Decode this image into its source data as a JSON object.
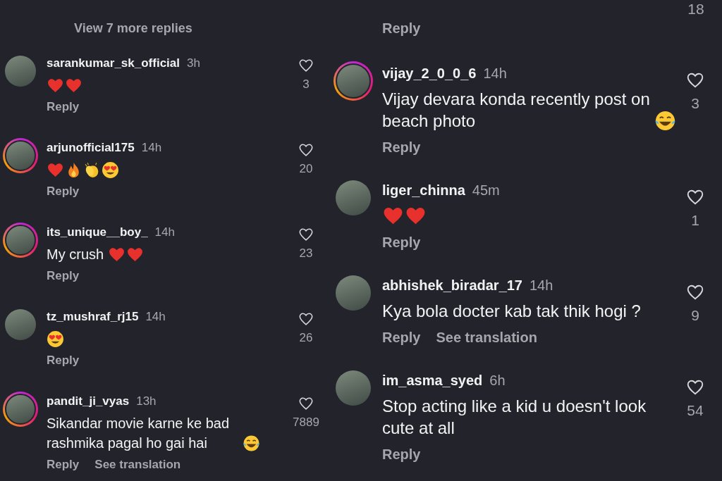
{
  "columns": [
    {
      "view_replies": "View 7 more replies",
      "comments": [
        {
          "username": "sarankumar_sk_official",
          "time": "3h",
          "emojis": [
            {
              "kind": "heart"
            },
            {
              "kind": "heart"
            }
          ],
          "actions": [
            "Reply"
          ],
          "likes": "3",
          "story_ring": false
        },
        {
          "username": "arjunofficial175",
          "time": "14h",
          "emojis": [
            {
              "kind": "heart"
            },
            {
              "kind": "fire"
            },
            {
              "kind": "clap"
            },
            {
              "kind": "heart-eyes"
            }
          ],
          "actions": [
            "Reply"
          ],
          "likes": "20",
          "story_ring": true
        },
        {
          "username": "its_unique__boy_",
          "time": "14h",
          "text": "My crush",
          "emojis": [
            {
              "kind": "heart"
            },
            {
              "kind": "heart"
            }
          ],
          "actions": [
            "Reply"
          ],
          "likes": "23",
          "story_ring": true
        },
        {
          "username": "tz_mushraf_rj15",
          "time": "14h",
          "emojis": [
            {
              "kind": "heart-eyes"
            }
          ],
          "actions": [
            "Reply"
          ],
          "likes": "26",
          "story_ring": false
        },
        {
          "username": "pandit_ji_vyas",
          "time": "13h",
          "text": "Sikandar movie karne ke bad rashmika pagal ho gai hai",
          "emojis": [
            {
              "kind": "laugh"
            }
          ],
          "actions": [
            "Reply",
            "See translation"
          ],
          "likes": "7889",
          "story_ring": true
        }
      ]
    },
    {
      "top_likes": "18",
      "top_reply": "Reply",
      "comments": [
        {
          "username": "vijay_2_0_0_6",
          "time": "14h",
          "text": "Vijay devara konda recently post on beach photo",
          "emojis": [
            {
              "kind": "laugh"
            }
          ],
          "actions": [
            "Reply"
          ],
          "likes": "3",
          "story_ring": true
        },
        {
          "username": "liger_chinna",
          "time": "45m",
          "emojis": [
            {
              "kind": "heart"
            },
            {
              "kind": "heart"
            }
          ],
          "actions": [
            "Reply"
          ],
          "likes": "1",
          "story_ring": false
        },
        {
          "username": "abhishek_biradar_17",
          "time": "14h",
          "text": "Kya bola docter kab tak thik hogi ?",
          "actions": [
            "Reply",
            "See translation"
          ],
          "likes": "9",
          "story_ring": false
        },
        {
          "username": "im_asma_syed",
          "time": "6h",
          "text": "Stop acting like a kid u doesn't look cute at all",
          "actions": [
            "Reply"
          ],
          "likes": "54",
          "story_ring": false
        }
      ]
    }
  ]
}
